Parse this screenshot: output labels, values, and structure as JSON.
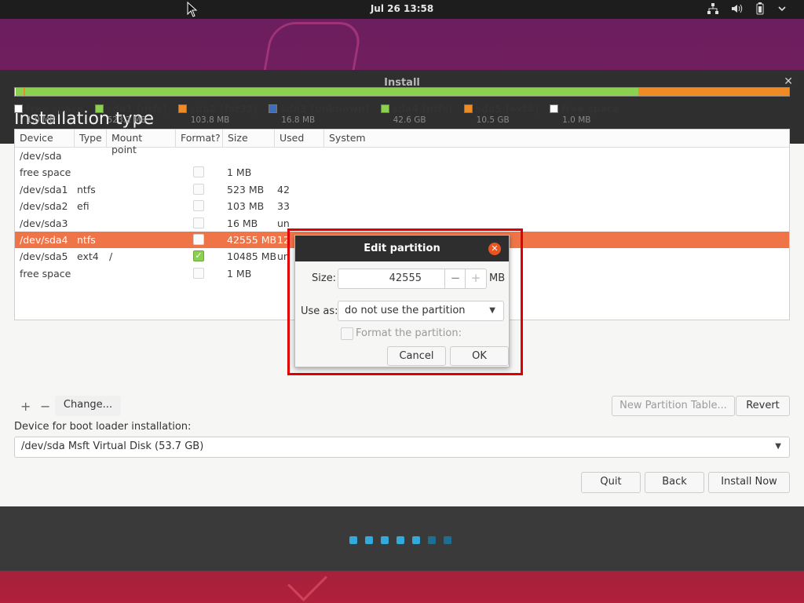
{
  "topbar": {
    "clock": "Jul 26  13:58"
  },
  "window": {
    "title": "Install",
    "heading": "Installation type"
  },
  "partition_bar": [
    {
      "color": "#ffffff",
      "pct": 0.1
    },
    {
      "color": "#8bd04f",
      "pct": 1.0
    },
    {
      "color": "#f08a24",
      "pct": 0.2
    },
    {
      "color": "#3e6dbb",
      "pct": 0.05
    },
    {
      "color": "#8bd04f",
      "pct": 79.2
    },
    {
      "color": "#f08a24",
      "pct": 19.45
    }
  ],
  "legend": [
    {
      "label": "free space",
      "size": "1.0 MB",
      "color": "#ffffff"
    },
    {
      "label": "sda1 (ntfs)",
      "size": "523.2 MB",
      "color": "#8bd04f"
    },
    {
      "label": "sda2 (fat32)",
      "size": "103.8 MB",
      "color": "#f08a24"
    },
    {
      "label": "sda3 (unknown)",
      "size": "16.8 MB",
      "color": "#3e6dbb"
    },
    {
      "label": "sda4 (ntfs)",
      "size": "42.6 GB",
      "color": "#8bd04f"
    },
    {
      "label": "sda5 (ext4)",
      "size": "10.5 GB",
      "color": "#f08a24"
    },
    {
      "label": "free space",
      "size": "1.0 MB",
      "color": "#ffffff"
    }
  ],
  "table": {
    "headers": [
      "Device",
      "Type",
      "Mount point",
      "Format?",
      "Size",
      "Used",
      "System"
    ],
    "rows": [
      {
        "device": "/dev/sda",
        "type": "",
        "mount": "",
        "format": null,
        "size": "",
        "used": ""
      },
      {
        "device": " free space",
        "type": "",
        "mount": "",
        "format": false,
        "size": "1 MB",
        "used": ""
      },
      {
        "device": " /dev/sda1",
        "type": "ntfs",
        "mount": "",
        "format": false,
        "size": "523 MB",
        "used": "42"
      },
      {
        "device": " /dev/sda2",
        "type": "efi",
        "mount": "",
        "format": false,
        "size": "103 MB",
        "used": "33"
      },
      {
        "device": " /dev/sda3",
        "type": "",
        "mount": "",
        "format": false,
        "size": "16 MB",
        "used": "un"
      },
      {
        "device": " /dev/sda4",
        "type": "ntfs",
        "mount": "",
        "format": false,
        "size": "42555 MB",
        "used": "12"
      },
      {
        "device": " /dev/sda5",
        "type": "ext4",
        "mount": "/",
        "format": true,
        "size": "10485 MB",
        "used": "un"
      },
      {
        "device": " free space",
        "type": "",
        "mount": "",
        "format": false,
        "size": "1 MB",
        "used": ""
      }
    ],
    "selected_row": 5
  },
  "controls": {
    "add": "+",
    "remove": "−",
    "change": "Change...",
    "new_table": "New Partition Table...",
    "revert": "Revert",
    "bootloader_label": "Device for boot loader installation:",
    "bootloader_value": "/dev/sda   Msft Virtual Disk (53.7 GB)",
    "quit": "Quit",
    "back": "Back",
    "install_now": "Install Now"
  },
  "progress_dots": [
    {
      "color": "#34aadc"
    },
    {
      "color": "#34aadc"
    },
    {
      "color": "#34aadc"
    },
    {
      "color": "#34aadc"
    },
    {
      "color": "#34aadc"
    },
    {
      "color": "#1f6f93"
    },
    {
      "color": "#1f6f93"
    }
  ],
  "dialog": {
    "title": "Edit partition",
    "size_label": "Size:",
    "size_value": "42555",
    "minus": "−",
    "plus": "+",
    "unit": "MB",
    "use_as_label": "Use as:",
    "use_as_value": "do not use the partition",
    "format_label": "Format the partition:",
    "cancel": "Cancel",
    "ok": "OK"
  },
  "colors": {
    "accent": "#e95420",
    "selected_row": "#ef7549",
    "highlight": "#e00000"
  }
}
